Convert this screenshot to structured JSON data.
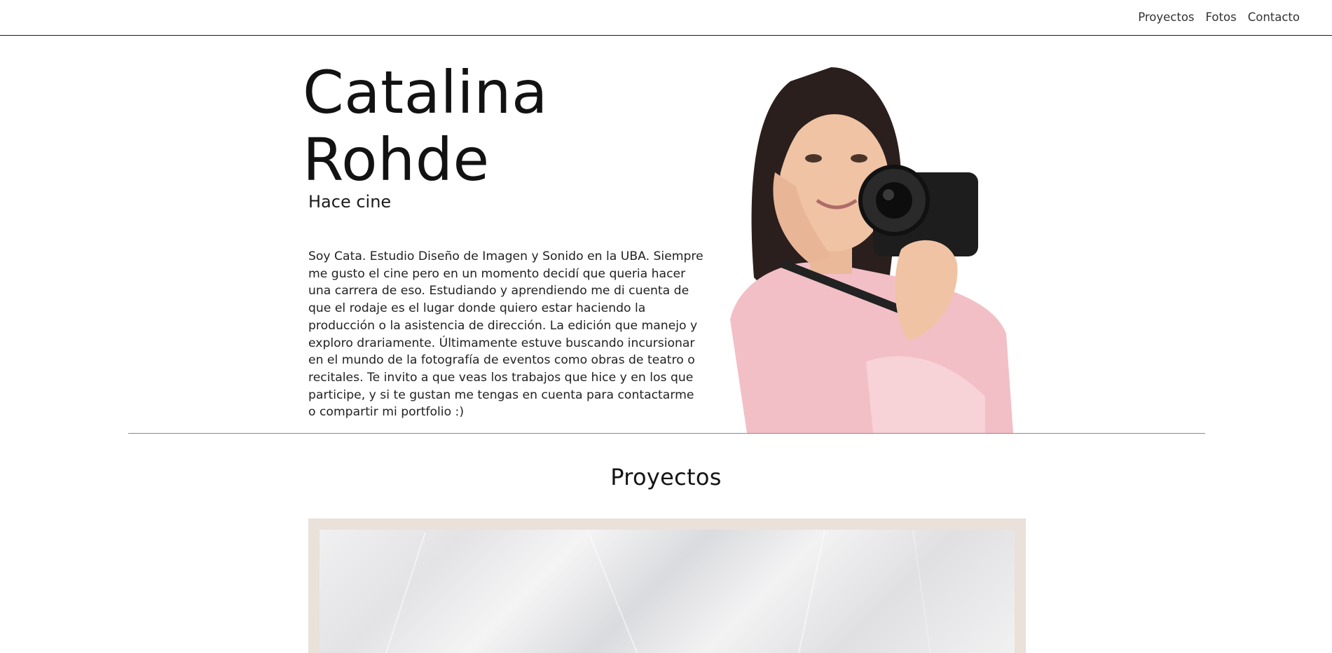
{
  "nav": {
    "items": [
      "Proyectos",
      "Fotos",
      "Contacto"
    ]
  },
  "hero": {
    "name_line1": "Catalina",
    "name_line2": "Rohde",
    "subtitle": "Hace cine",
    "bio": "Soy Cata. Estudio Diseño de Imagen y Sonido en la UBA. Siempre me gusto el cine pero en un momento decidí que queria hacer una carrera de eso. Estudiando y aprendiendo me di cuenta de que el rodaje es el lugar donde quiero estar haciendo la producción o la asistencia de dirección. La edición que manejo y exploro drariamente. Últimamente estuve buscando incursionar en el mundo de la fotografía de eventos como obras de teatro o recitales. Te invito a que veas los trabajos que hice y en los que participe, y si te gustan me tengas en cuenta para contactarme o compartir mi portfolio :)"
  },
  "projects": {
    "title": "Proyectos"
  },
  "colors": {
    "card_border": "#e9e1da",
    "divider": "#8a8a8a",
    "sweater_pink": "#f2bfc6"
  }
}
